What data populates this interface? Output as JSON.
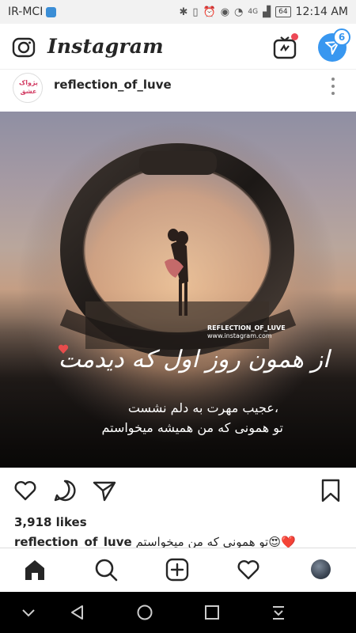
{
  "status_bar": {
    "carrier": "IR-MCI",
    "battery": "64",
    "time": "12:14 AM",
    "network": "4G"
  },
  "header": {
    "logo": "Instagram",
    "dm_badge": "6"
  },
  "post": {
    "username": "reflection_of_luve",
    "avatar_text": "پژواک عشق",
    "watermark_handle": "REFLECTION_OF_LUVE",
    "watermark_site": "www.instagram.com",
    "quote_title": "از همون روز اول که دیدمت",
    "quote_line1": "عجیب مهرت به دلم نشست،",
    "quote_line2": "تو همونی که من همیشه میخواستم",
    "likes": "3,918 likes",
    "caption_user": "reflection_of_luve",
    "caption_text": "تو همونی که من میخواستم😍❤️"
  },
  "colors": {
    "accent_blue": "#3897f0",
    "notification_red": "#ed4956",
    "heart_red": "#e74c4c"
  },
  "icons": {
    "camera": "camera-icon",
    "igtv": "igtv-icon",
    "direct": "direct-message-icon",
    "like": "heart-icon",
    "comment": "comment-icon",
    "share": "share-icon",
    "save": "bookmark-icon",
    "home": "home-icon",
    "search": "search-icon",
    "new_post": "new-post-icon",
    "activity": "activity-heart-icon"
  }
}
